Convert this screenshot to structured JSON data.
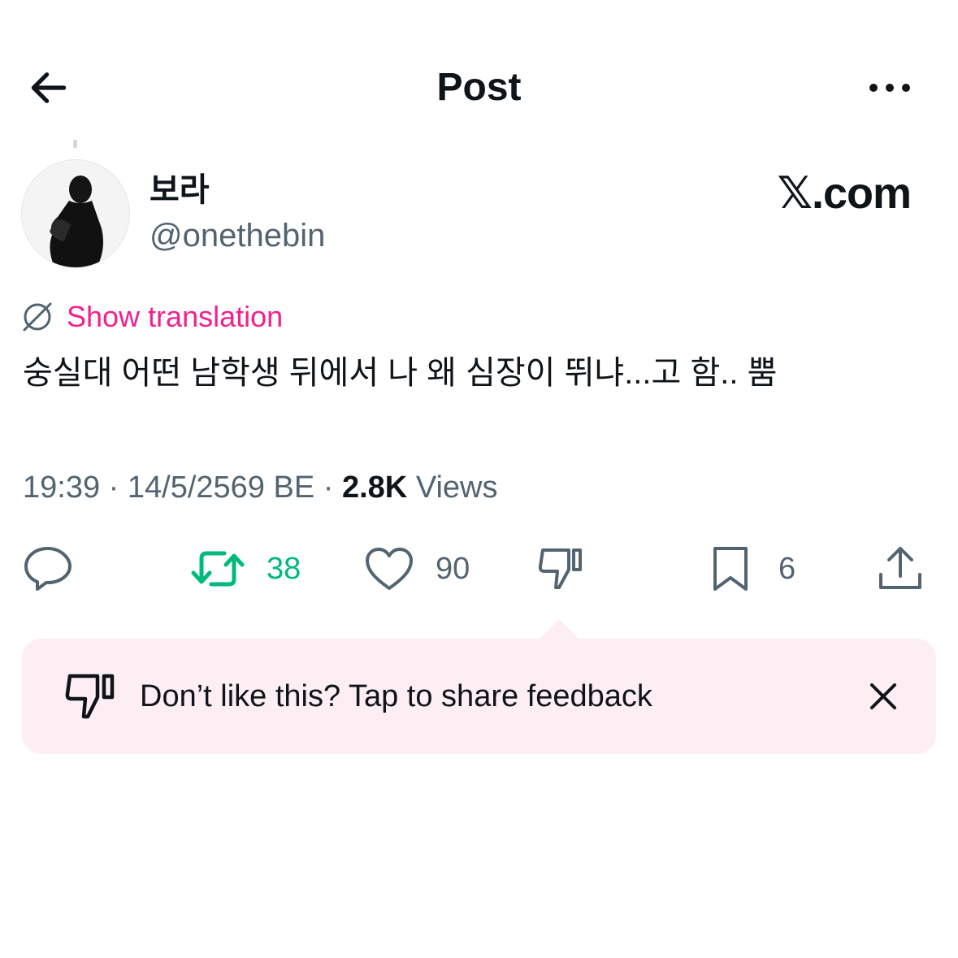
{
  "header": {
    "title": "Post",
    "back_icon": "arrow-left-icon",
    "more_icon": "more-icon"
  },
  "post": {
    "display_name": "보라",
    "handle": "@onethebin",
    "brand": "𝕏.com",
    "translate_label": "Show translation",
    "text": "숭실대 어떤 남학생 뒤에서 나 왜 심장이 뛰냐...고 함.. 뿜",
    "time": "19:39",
    "date": "14/5/2569 BE",
    "views_count": "2.8K",
    "views_label": "Views"
  },
  "actions": {
    "reply_count": "",
    "retweet_count": "38",
    "like_count": "90",
    "bookmark_count": "6"
  },
  "feedback": {
    "text": "Don’t like this? Tap to share feedback"
  },
  "colors": {
    "pink": "#f4208c",
    "green": "#00ba7c",
    "gray": "#536471",
    "banner": "#fdeef4"
  }
}
